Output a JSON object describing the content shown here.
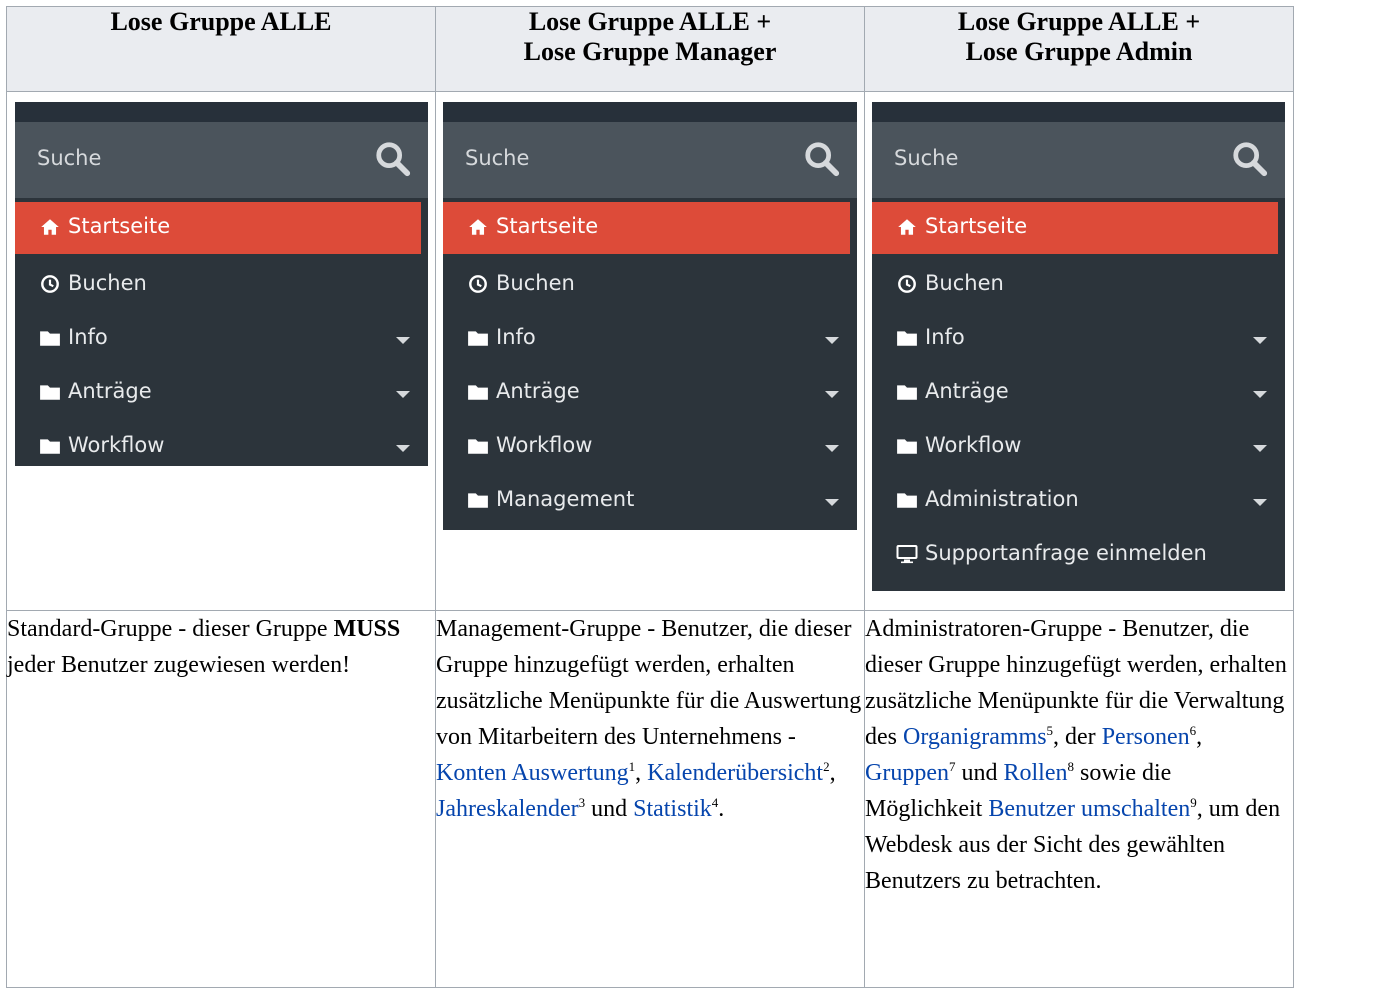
{
  "headers": [
    {
      "line1": "Lose Gruppe ALLE",
      "line2": ""
    },
    {
      "line1": "Lose Gruppe ALLE +",
      "line2": "Lose Gruppe Manager"
    },
    {
      "line1": "Lose Gruppe ALLE +",
      "line2": "Lose Gruppe Admin"
    }
  ],
  "menus": {
    "search_placeholder": "Suche",
    "col1": [
      "Startseite",
      "Buchen",
      "Info",
      "Anträge",
      "Workflow"
    ],
    "col2": [
      "Startseite",
      "Buchen",
      "Info",
      "Anträge",
      "Workflow",
      "Management"
    ],
    "col3": [
      "Startseite",
      "Buchen",
      "Info",
      "Anträge",
      "Workflow",
      "Administration",
      "Supportanfrage einmelden"
    ]
  },
  "icons": {
    "home": "home-icon",
    "clock": "clock-icon",
    "folder": "folder-icon",
    "monitor": "monitor-icon",
    "search": "search-icon",
    "caret": "caret-down-icon"
  },
  "colors": {
    "sidebar_bg": "#2c343b",
    "search_bg": "#4b545c",
    "active_bg": "#dd4b39",
    "header_bg": "#eaecf0",
    "link": "#0645ad"
  },
  "descriptions": {
    "col1": {
      "t1": "Standard-Gruppe - dieser Gruppe ",
      "bold": "MUSS",
      "t2": " jeder Benutzer zugewiesen werden!"
    },
    "col2": {
      "t1": "Management-Gruppe - Benutzer, die dieser Gruppe hinzugefügt werden, erhalten zusätzliche Menüpunkte für die Auswertung von Mitarbeitern des Unternehmens - ",
      "link1": "Konten Auswertung",
      "sup1": "1",
      "sep1": ", ",
      "link2": "Kalenderübersicht",
      "sup2": "2",
      "sep2": ", ",
      "link3": "Jahreskalender",
      "sup3": "3",
      "sep3": " und ",
      "link4": "Statistik",
      "sup4": "4",
      "end": "."
    },
    "col3": {
      "t1": "Administratoren-Gruppe - Benutzer, die dieser Gruppe hinzugefügt werden, erhalten zusätzliche Menüpunkte für die Verwaltung des ",
      "link1": "Organigramms",
      "sup1": "5",
      "sep1": ", der ",
      "link2": "Personen",
      "sup2": "6",
      "sep2": ", ",
      "link3": "Gruppen",
      "sup3": "7",
      "sep3": " und ",
      "link4": "Rollen",
      "sup4": "8",
      "sep4": " sowie die Möglichkeit ",
      "link5": "Benutzer umschalten",
      "sup5": "9",
      "end": ", um den Webdesk aus der Sicht des gewählten Benutzers zu betrachten."
    }
  }
}
